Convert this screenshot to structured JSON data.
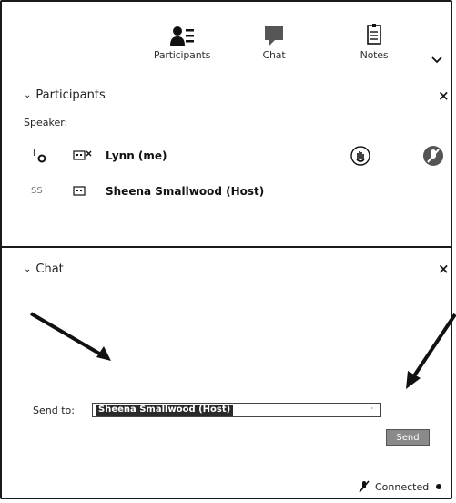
{
  "toolbar": {
    "participants_label": "Participants",
    "chat_label": "Chat",
    "notes_label": "Notes",
    "more_icon": "chevron-down-icon"
  },
  "participants_panel": {
    "title": "Participants",
    "speaker_label": "Speaker:",
    "rows": [
      {
        "prefix": "l",
        "name": "Lynn (me)"
      },
      {
        "prefix": "SS",
        "name": "Sheena Smallwood (Host)"
      }
    ]
  },
  "chat_panel": {
    "title": "Chat",
    "send_to_label": "Send to:",
    "send_to_value": "Sheena Smallwood (Host)",
    "send_label": "Send"
  },
  "status": {
    "text": "Connected"
  }
}
